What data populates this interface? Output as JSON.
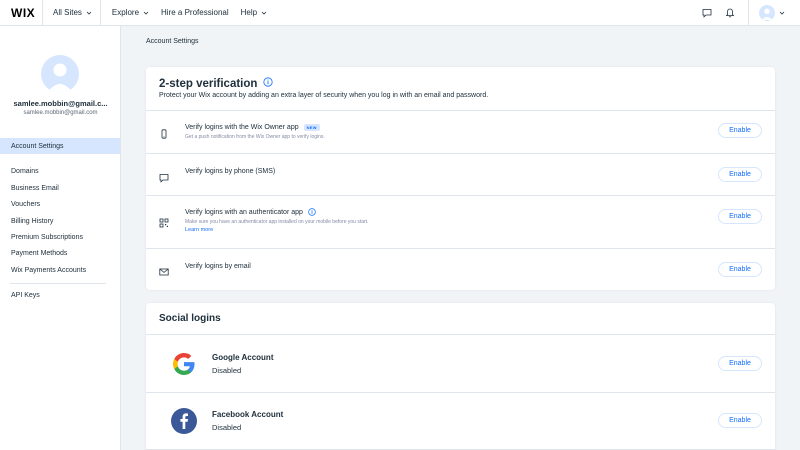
{
  "topbar": {
    "logo": "WIX",
    "all_sites": "All Sites",
    "explore": "Explore",
    "hire": "Hire a Professional",
    "help": "Help"
  },
  "sidebar": {
    "user_name": "samlee.mobbin@gmail.c...",
    "user_email": "samlee.mobbin@gmail.com",
    "active_item": "Account Settings",
    "items": [
      "Domains",
      "Business Email",
      "Vouchers",
      "Billing History",
      "Premium Subscriptions",
      "Payment Methods",
      "Wix Payments Accounts"
    ],
    "extra_item": "API Keys"
  },
  "breadcrumb": "Account Settings",
  "two_step": {
    "title": "2-step verification",
    "subtitle": "Protect your Wix account by adding an extra layer of security when you log in with an email and password.",
    "rows": [
      {
        "icon": "phone-icon",
        "title": "Verify logins with the Wix Owner app",
        "badge": "NEW",
        "desc": "Get a push notification from the Wix Owner app to verify logins.",
        "button": "Enable"
      },
      {
        "icon": "chat-bubble-icon",
        "title": "Verify logins by phone (SMS)",
        "button": "Enable"
      },
      {
        "icon": "qr-code-icon",
        "title": "Verify logins with an authenticator app",
        "desc": "Make sure you have an authenticator app installed on your mobile before you start.",
        "link": "Learn more",
        "button": "Enable"
      },
      {
        "icon": "envelope-icon",
        "title": "Verify logins by email",
        "button": "Enable"
      }
    ]
  },
  "social": {
    "title": "Social logins",
    "rows": [
      {
        "icon": "google-icon",
        "name": "Google Account",
        "status": "Disabled",
        "button": "Enable"
      },
      {
        "icon": "facebook-icon",
        "name": "Facebook Account",
        "status": "Disabled",
        "button": "Enable"
      }
    ]
  },
  "colors": {
    "accent": "#116dff",
    "active_bg": "#d6e6fe",
    "page_bg": "#f0f4f7",
    "facebook": "#3b5998"
  }
}
